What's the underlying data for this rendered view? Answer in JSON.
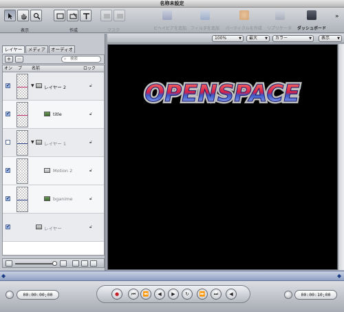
{
  "window": {
    "title": "名称未設定"
  },
  "toolbar": {
    "groups": [
      {
        "label": "表示"
      },
      {
        "label": "作成"
      },
      {
        "label": "マスク"
      }
    ],
    "actions": [
      {
        "label": "ビヘイビアを追加"
      },
      {
        "label": "フィルタを追加"
      },
      {
        "label": "パーティクルを作成"
      },
      {
        "label": "リプリケータ"
      },
      {
        "label": "ダッシュボード"
      }
    ],
    "overflow": "»"
  },
  "viewer_bar": {
    "zoom": "100%",
    "quality": "最大",
    "channel": "カラー",
    "view": "表示"
  },
  "panel": {
    "tabs": [
      {
        "label": "レイヤー"
      },
      {
        "label": "メディア"
      },
      {
        "label": "オーディオ"
      }
    ],
    "add": "+",
    "remove": "−",
    "search_placeholder": "検索",
    "columns": {
      "on": "オン",
      "preview": "プ",
      "name": "名前",
      "lock": "ロック"
    },
    "rows": [
      {
        "name": "レイヤー 2",
        "checked": true
      },
      {
        "name": "title",
        "checked": true
      },
      {
        "name": "レイヤー 1",
        "checked": false
      },
      {
        "name": "Motion 2",
        "checked": true
      },
      {
        "name": "bganime",
        "checked": true
      },
      {
        "name": "レイヤー",
        "checked": true
      }
    ]
  },
  "canvas": {
    "logo_text": "OPENSPACE"
  },
  "transport": {
    "current_time": "00:00:00;00",
    "duration": "00:00:10;00"
  },
  "colors": {
    "viewer_bg": "#000000",
    "accent": "#3a5fb0"
  }
}
